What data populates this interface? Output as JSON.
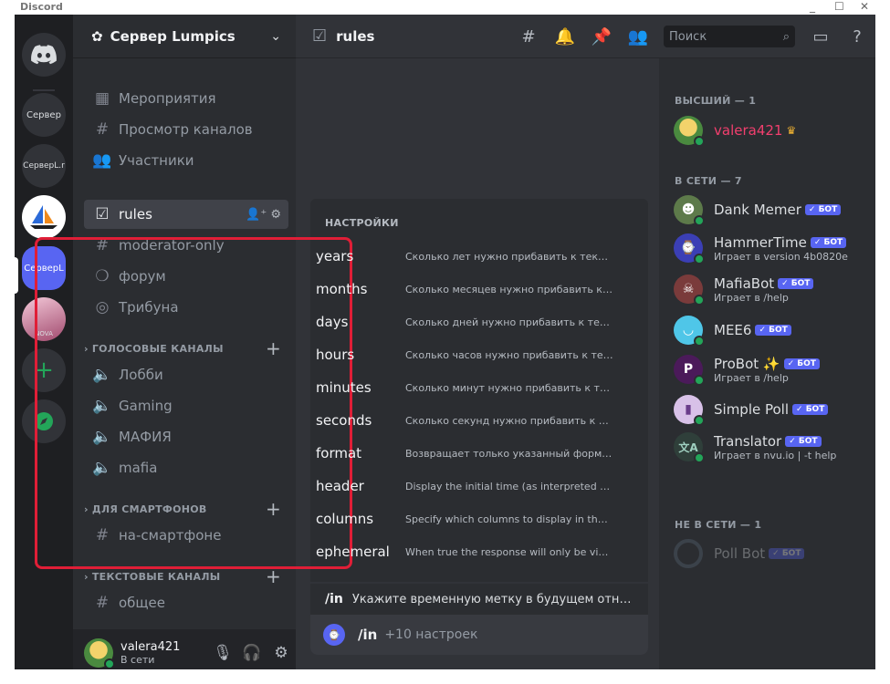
{
  "app_title": "Discord",
  "window_controls": [
    "_",
    "☐",
    "✕"
  ],
  "servers": [
    {
      "label": "Сервер"
    },
    {
      "label": "СерверL.r"
    },
    {
      "label": ""
    },
    {
      "label": "СерверL"
    },
    {
      "label": "NOVA"
    }
  ],
  "server_header": {
    "name": "Сервер Lumpics"
  },
  "sidebar": {
    "top_items": [
      {
        "label": "Мероприятия",
        "icon": "calendar-icon"
      },
      {
        "label": "Просмотр каналов",
        "icon": "channels-browse-icon"
      },
      {
        "label": "Участники",
        "icon": "members-icon"
      }
    ],
    "channels": [
      {
        "label": "rules",
        "icon": "rules-icon"
      },
      {
        "label": "moderator-only",
        "icon": "hash-icon"
      },
      {
        "label": "форум",
        "icon": "forum-icon"
      },
      {
        "label": "Трибуна",
        "icon": "stage-icon"
      }
    ],
    "voice_category": "ГОЛОСОВЫЕ КАНАЛЫ",
    "voice": [
      "Лобби",
      "Gaming",
      "МАФИЯ",
      "mafia"
    ],
    "phone_category": "ДЛЯ СМАРТФОНОВ",
    "phone": [
      "на-смартфоне"
    ],
    "text_category": "ТЕКСТОВЫЕ КАНАЛЫ",
    "text": [
      "общее"
    ]
  },
  "user_panel": {
    "name": "valera421",
    "status": "В сети"
  },
  "main": {
    "channel_title": "rules",
    "search_placeholder": "Поиск",
    "popup_header": "НАСТРОЙКИ",
    "options": [
      {
        "name": "years",
        "desc": "Сколько лет нужно прибавить к текущем..."
      },
      {
        "name": "months",
        "desc": "Сколько месяцев нужно прибавить к теку..."
      },
      {
        "name": "days",
        "desc": "Сколько дней нужно прибавить к текуще..."
      },
      {
        "name": "hours",
        "desc": "Сколько часов нужно прибавить к текущ..."
      },
      {
        "name": "minutes",
        "desc": "Сколько минут нужно прибавить к текущ..."
      },
      {
        "name": "seconds",
        "desc": "Сколько секунд нужно прибавить к теку..."
      },
      {
        "name": "format",
        "desc": "Возвращает только указанный формат в ..."
      },
      {
        "name": "header",
        "desc": "Display the initial time (as interpreted by t..."
      },
      {
        "name": "columns",
        "desc": "Specify which columns to display in the ret..."
      },
      {
        "name": "ephemeral",
        "desc": "When true the response will only be visible ..."
      }
    ],
    "command": {
      "name": "/in",
      "desc": "Укажите временную метку в будущем относите..."
    },
    "input": {
      "command": "/in",
      "hint": "+10 настроек"
    },
    "highlight_color": "#e01e37"
  },
  "members": {
    "top_category": "ВЫСШИЙ — 1",
    "online_category": "В СЕТИ — 7",
    "offline_category": "НЕ В СЕТИ — 1",
    "bot_badge": "✓ БОТ",
    "owner": {
      "name": "valera421",
      "color": "#f23f6e"
    },
    "online": [
      {
        "name": "Dank Memer",
        "activity": "",
        "bot": true
      },
      {
        "name": "HammerTime",
        "activity": "Играет в version 4b0820e",
        "bot": true
      },
      {
        "name": "MafiaBot",
        "activity": "Играет в /help",
        "bot": true
      },
      {
        "name": "MEE6",
        "activity": "",
        "bot": true
      },
      {
        "name": "ProBot ✨",
        "activity": "Играет в /help",
        "bot": true
      },
      {
        "name": "Simple Poll",
        "activity": "",
        "bot": true
      },
      {
        "name": "Translator",
        "activity": "Играет в nvu.io | -t help",
        "bot": true
      }
    ],
    "offline": [
      {
        "name": "Poll Bot",
        "bot": true
      }
    ]
  }
}
